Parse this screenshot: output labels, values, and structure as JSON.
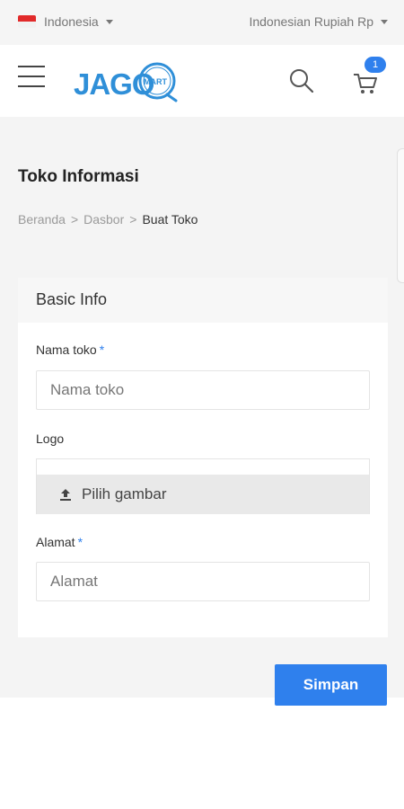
{
  "topbar": {
    "language": "Indonesia",
    "currency": "Indonesian Rupiah Rp"
  },
  "header": {
    "logo_text": "JAGO",
    "logo_sub": "MART",
    "cart_count": "1"
  },
  "page": {
    "title": "Toko Informasi",
    "breadcrumb": [
      {
        "label": "Beranda"
      },
      {
        "label": "Dasbor"
      },
      {
        "label": "Buat Toko"
      }
    ],
    "breadcrumb_separator": ">"
  },
  "form": {
    "section_title": "Basic Info",
    "store_name": {
      "label": "Nama toko",
      "required_mark": "*",
      "placeholder": "Nama toko",
      "value": ""
    },
    "logo": {
      "label": "Logo",
      "button_label": "Pilih gambar"
    },
    "address": {
      "label": "Alamat",
      "required_mark": "*",
      "placeholder": "Alamat",
      "value": ""
    },
    "submit_label": "Simpan"
  },
  "colors": {
    "accent": "#2f80ed",
    "logo_blue": "#2f8fd8",
    "page_bg": "#f4f4f4"
  },
  "icons": [
    "flag-indonesia-icon",
    "caret-down-icon",
    "menu-icon",
    "search-icon",
    "cart-icon",
    "upload-icon"
  ]
}
